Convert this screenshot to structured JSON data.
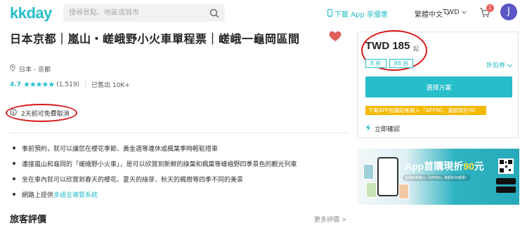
{
  "header": {
    "logo": "kkday",
    "search_placeholder": "搜尋景點、地區或城市",
    "app_link": "下載 App 享優惠",
    "language": "繁體中文",
    "currency": "TWD",
    "cart_count": "1",
    "avatar_initial": "J"
  },
  "product": {
    "title": "日本京都｜嵐山・嵯峨野小火車單程票｜嵯峨一龜岡區間",
    "location": "日本 - 京都",
    "rating": "4.7",
    "review_count": "(1,519)",
    "sold": "已售出 10K+",
    "cancellation": "2天前可免費取消",
    "bullets": [
      {
        "text": "事前預約，就可以讓您在櫻花季節、黃金週等連休或楓葉季時輕鬆搭車",
        "link": ""
      },
      {
        "text": "連接嵐山和龜岡的「嵯峨野小火車」，是可以欣賞到新鮮的綠葉和楓葉等嵯峨野四季景色的觀光列車",
        "link": ""
      },
      {
        "text": "坐在車內就可以欣賞到春天的櫻花、夏天的綠芽、秋天的楓樹等四季不同的美景",
        "link": ""
      },
      {
        "text": "網路上提供",
        "link": "多語言導覽系統"
      }
    ],
    "reviews_title": "旅客評價",
    "more_reviews": "更多評價 >"
  },
  "booking": {
    "price": "TWD 185",
    "price_suffix": "起",
    "tags": [
      "8 折",
      "88 折"
    ],
    "discount_link": "折扣券",
    "select_button": "選擇方案",
    "promo": "下載APP首購結帳輸入「APP90」滿額現折90",
    "instant_confirm": "立即確認"
  },
  "ad": {
    "title_prefix": "App首購現折",
    "title_highlight": "90",
    "title_suffix": "元",
    "subtitle": "首購結帳輸入「APP90」滿額折扣優惠！"
  },
  "colors": {
    "brand": "#26bec9",
    "highlight_oval": "#d81818",
    "promo": "#f5b800",
    "heart": "#e06060",
    "avatar": "#5b57c7"
  }
}
